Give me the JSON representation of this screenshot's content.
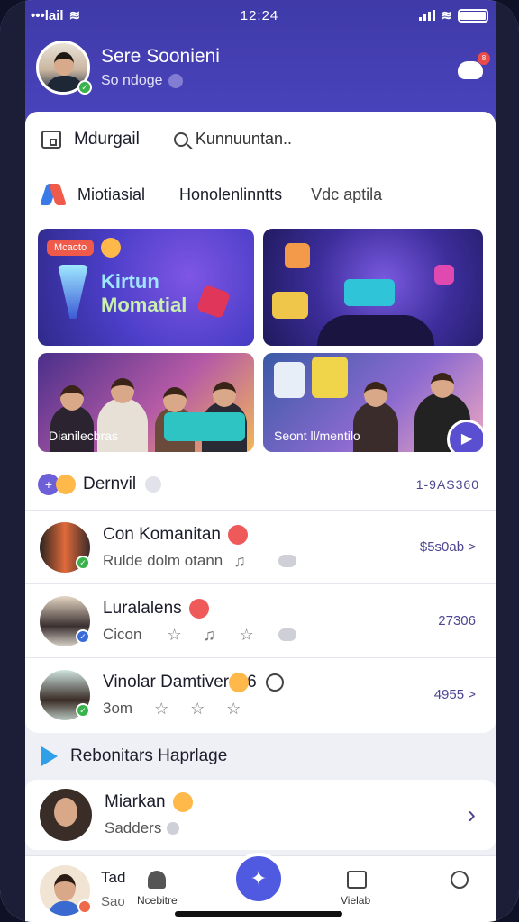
{
  "status_bar": {
    "carrier": "•••lail",
    "time": "12:24"
  },
  "profile": {
    "name": "Sere Soonieni",
    "status": "So ndoge"
  },
  "header_badge": {
    "count": "8"
  },
  "top_tabs": {
    "home_label": "Mdurgail",
    "search_label": "Kunnuuntan.."
  },
  "section_tabs": [
    "Miotiasial",
    "Honolenlinntts",
    "Vdc aptila"
  ],
  "tiles": [
    {
      "pill": "Mcaoto",
      "title_line1": "Kirtun",
      "title_line2": "Momatial"
    },
    {
      "caption": ""
    },
    {
      "caption": "Dianilecbras"
    },
    {
      "caption": "Seont ll/mentilo"
    }
  ],
  "section": {
    "title": "Dernvil",
    "value": "1-9AS360"
  },
  "list": [
    {
      "title": "Con Komanitan",
      "subtitle": "Rulde dolm otann",
      "meta": "$5s0ab >"
    },
    {
      "title": "Luralalens",
      "subtitle": "Cicon",
      "meta": "27306"
    },
    {
      "title": "Vinolar Damtiver",
      "title_suffix": "6",
      "subtitle": "3om",
      "meta": "4955 >"
    }
  ],
  "recommended": {
    "title": "Rebonitars Haprlage",
    "item": {
      "name": "Miarkan",
      "subtitle": "Sadders",
      "chevron": "›"
    }
  },
  "bottom_bar": {
    "me_name": "Tad",
    "me_sub": "Sao",
    "nav": [
      "Ncebitre",
      "",
      "Vielab",
      ""
    ]
  },
  "colors": {
    "header": "#4a44bd",
    "accent": "#4f5ae0",
    "bg": "#efeff6"
  }
}
